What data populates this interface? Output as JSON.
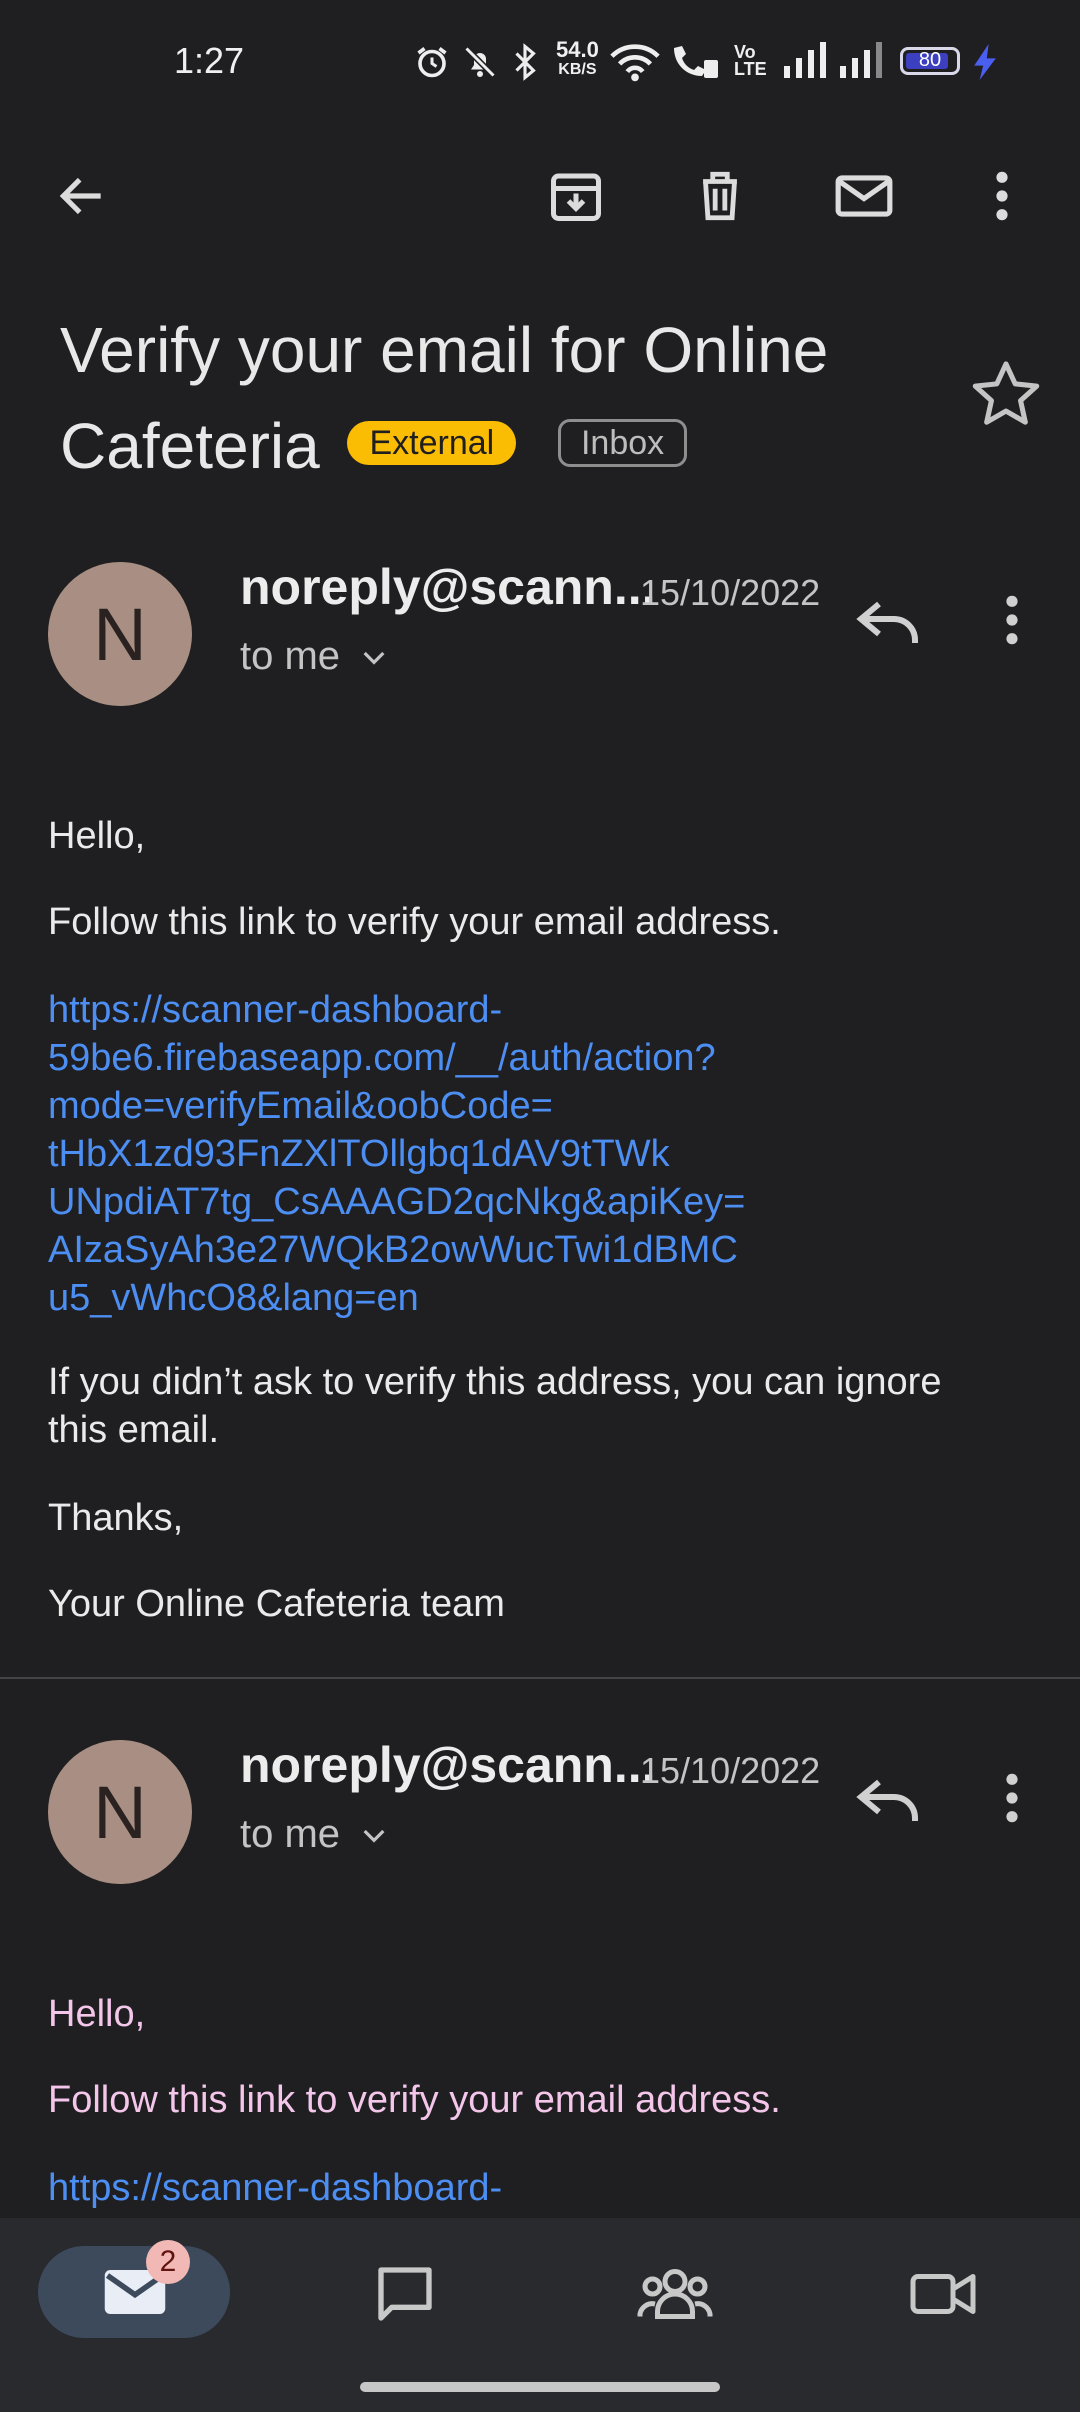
{
  "status_bar": {
    "time": "1:27",
    "speed_value": "54.0",
    "speed_unit": "KB/S",
    "battery": "80"
  },
  "toolbar": {
    "icons": [
      "back-arrow-icon",
      "archive-icon",
      "delete-icon",
      "mark-unread-icon",
      "more-vert-icon"
    ]
  },
  "email": {
    "subject": "Verify your email for Online Cafeteria",
    "labels": [
      "External",
      "Inbox"
    ]
  },
  "messages": [
    {
      "avatar_letter": "N",
      "sender": "noreply@scann...",
      "date": "15/10/2022",
      "recipient": "to me",
      "greeting": "Hello,",
      "intro": "Follow this link to verify your email address.",
      "link_lines": [
        "https://scanner-dashboard-",
        "59be6.firebaseapp.com/__/auth/action?",
        "mode=verifyEmail&oobCode=",
        "tHbX1zd93FnZXlTOllgbq1dAV9tTWk",
        "UNpdiAT7tg_CsAAAGD2qcNkg&apiKey=",
        "AIzaSyAh3e27WQkB2owWucTwi1dBMC",
        "u5_vWhcO8&lang=en"
      ],
      "ignore_line1": "If you didn’t ask to verify this address, you can ignore",
      "ignore_line2": "this email.",
      "thanks": "Thanks,",
      "signature": "Your Online Cafeteria team"
    },
    {
      "avatar_letter": "N",
      "sender": "noreply@scann...",
      "date": "15/10/2022",
      "recipient": "to me",
      "greeting": "Hello,",
      "intro": "Follow this link to verify your email address.",
      "link_first_line": "https://scanner-dashboard-"
    }
  ],
  "bottom_nav": {
    "mail_badge": "2",
    "items": [
      "mail-icon",
      "chat-icon",
      "spaces-icon",
      "meet-icon"
    ]
  },
  "colors": {
    "background": "#1f1f21",
    "link": "#4d8ef2",
    "external_chip": "#fbbc04",
    "avatar": "#a98f83"
  }
}
